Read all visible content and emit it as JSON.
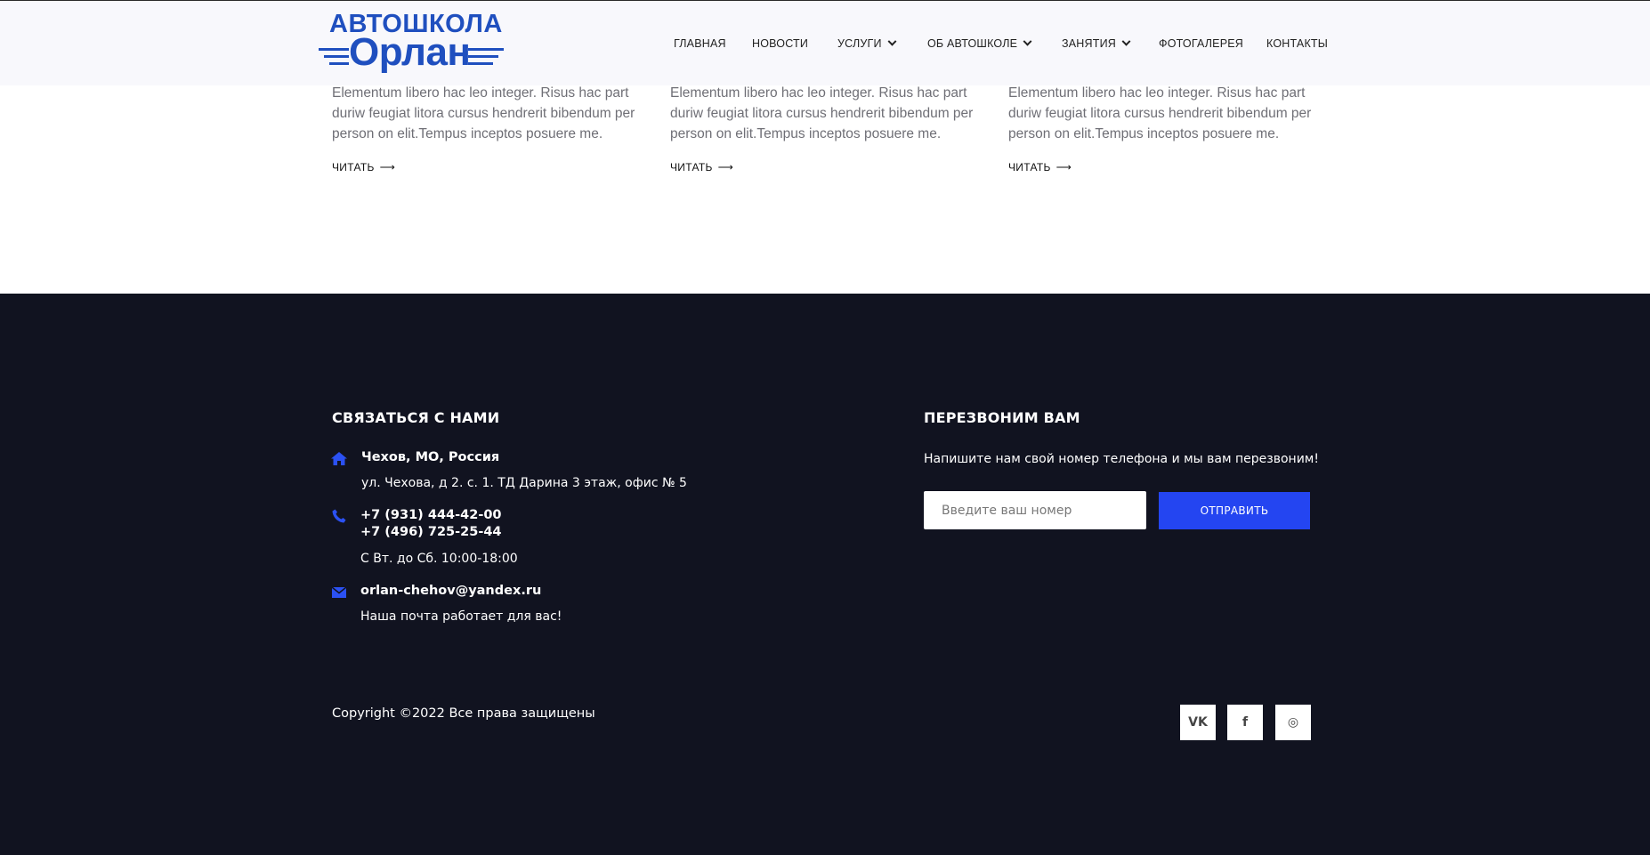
{
  "header": {
    "logo_top": "АВТОШКОЛА",
    "logo_bottom": "Орлан",
    "nav": [
      {
        "label": "ГЛАВНАЯ"
      },
      {
        "label": "НОВОСТИ"
      },
      {
        "label": "УСЛУГИ"
      },
      {
        "label": "ОБ АВТОШКОЛЕ"
      },
      {
        "label": "ЗАНЯТИЯ"
      },
      {
        "label": "ФОТОГАЛЕРЕЯ"
      },
      {
        "label": "КОНТАКТЫ"
      }
    ]
  },
  "articles": [
    {
      "text": "Elementum libero hac leo integer. Risus hac part duriw feugiat litora cursus hendrerit bibendum per person on elit.Tempus inceptos posuere me.",
      "read_more": "ЧИТАТЬ"
    },
    {
      "text": "Elementum libero hac leo integer. Risus hac part duriw feugiat litora cursus hendrerit bibendum per person on elit.Tempus inceptos posuere me.",
      "read_more": "ЧИТАТЬ"
    },
    {
      "text": "Elementum libero hac leo integer. Risus hac part duriw feugiat litora cursus hendrerit bibendum per person on elit.Tempus inceptos posuere me.",
      "read_more": "ЧИТАТЬ"
    }
  ],
  "footer": {
    "contact_title": "СВЯЗАТЬСЯ С НАМИ",
    "address_city": "Чехов, МО, Россия",
    "address_street": "ул. Чехова, д 2. с. 1. ТД Дарина 3 этаж, офис № 5",
    "phone_1": "+7 (931) 444-42-00",
    "phone_2": "+7 (496) 725-25-44",
    "hours": "С Вт. до Сб. 10:00-18:00",
    "email": "orlan-chehov@yandex.ru",
    "email_note": "Наша почта работает для вас!",
    "callback_title": "ПЕРЕЗВОНИМ ВАМ",
    "callback_text": "Напишите нам свой номер телефона и мы вам перезвоним!",
    "phone_placeholder": "Введите ваш номер",
    "send_label": "ОТПРАВИТЬ",
    "copyright": "Copyright ©2022 Все права защищены",
    "social": [
      {
        "label": "VK"
      },
      {
        "label": "f"
      },
      {
        "label": "◎"
      }
    ]
  },
  "colors": {
    "accent": "#2445f1",
    "footer_bg": "#111320",
    "logo_blue": "#1f4fbf"
  }
}
